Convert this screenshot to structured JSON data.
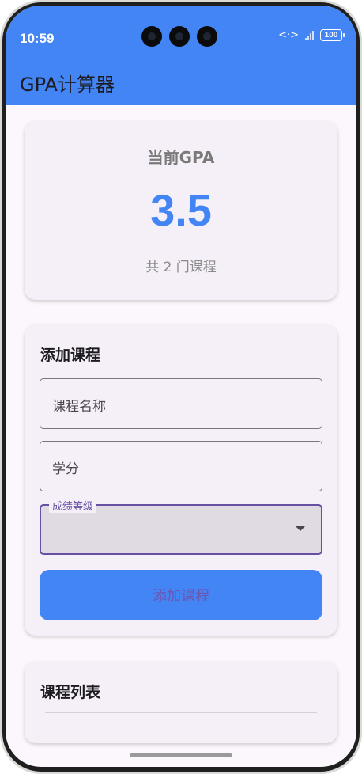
{
  "status_bar": {
    "time": "10:59",
    "battery": "100",
    "icons": [
      "data-transfer-icon",
      "signal-icon",
      "battery-icon"
    ]
  },
  "app_bar": {
    "title": "GPA计算器"
  },
  "gpa_card": {
    "label": "当前GPA",
    "value": "3.5",
    "course_count_text": "共 2 门课程"
  },
  "add_course": {
    "title": "添加课程",
    "course_name_placeholder": "课程名称",
    "credit_placeholder": "学分",
    "grade_label": "成绩等级",
    "grade_value": "",
    "submit_label": "添加课程"
  },
  "course_list": {
    "title": "课程列表"
  },
  "colors": {
    "primary": "#4385f5",
    "accent": "#6750a4",
    "surface": "#f5eff7",
    "background": "#fcf7fc"
  }
}
